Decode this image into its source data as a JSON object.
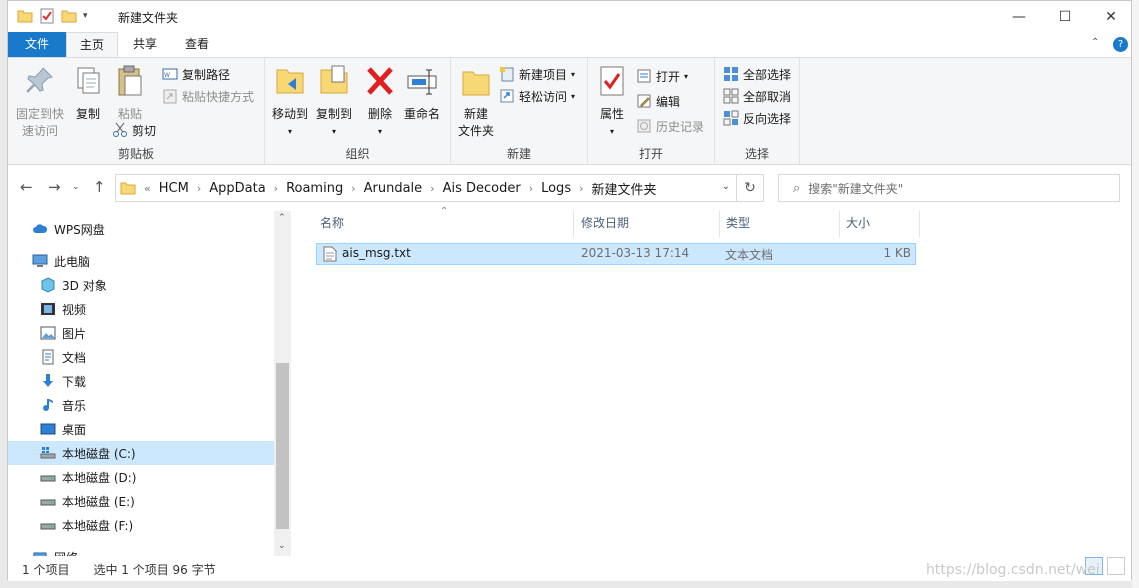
{
  "window": {
    "title": "新建文件夹",
    "controls": {
      "minimize": "—",
      "maximize": "☐",
      "close": "✕"
    }
  },
  "tabs": [
    "文件",
    "主页",
    "共享",
    "查看"
  ],
  "ribbon": {
    "clipboard": {
      "label": "剪贴板",
      "pin_line1": "固定到快",
      "pin_line2": "速访问",
      "copy": "复制",
      "paste": "粘贴",
      "copy_path": "复制路径",
      "paste_shortcut": "粘贴快捷方式",
      "cut": "剪切"
    },
    "organize": {
      "label": "组织",
      "move_to": "移动到",
      "copy_to": "复制到",
      "delete": "删除",
      "rename": "重命名"
    },
    "new": {
      "label": "新建",
      "new_folder_line1": "新建",
      "new_folder_line2": "文件夹",
      "new_item": "新建项目",
      "easy_access": "轻松访问"
    },
    "open": {
      "label": "打开",
      "properties": "属性",
      "open": "打开",
      "edit": "编辑",
      "history": "历史记录"
    },
    "select": {
      "label": "选择",
      "select_all": "全部选择",
      "select_none": "全部取消",
      "invert": "反向选择"
    }
  },
  "address": {
    "crumbs": [
      "HCM",
      "AppData",
      "Roaming",
      "Arundale",
      "Ais Decoder",
      "Logs",
      "新建文件夹"
    ],
    "overflow": "«",
    "search_placeholder": "搜索\"新建文件夹\""
  },
  "nav": {
    "items": [
      {
        "label": "WPS网盘",
        "icon": "cloud-icon"
      },
      {
        "label": "此电脑",
        "icon": "computer-icon"
      },
      {
        "label": "3D 对象",
        "icon": "cube-icon"
      },
      {
        "label": "视频",
        "icon": "video-icon"
      },
      {
        "label": "图片",
        "icon": "picture-icon"
      },
      {
        "label": "文档",
        "icon": "document-icon"
      },
      {
        "label": "下载",
        "icon": "download-icon"
      },
      {
        "label": "音乐",
        "icon": "music-icon"
      },
      {
        "label": "桌面",
        "icon": "desktop-icon"
      },
      {
        "label": "本地磁盘 (C:)",
        "icon": "drive-icon"
      },
      {
        "label": "本地磁盘 (D:)",
        "icon": "drive-icon"
      },
      {
        "label": "本地磁盘 (E:)",
        "icon": "drive-icon"
      },
      {
        "label": "本地磁盘 (F:)",
        "icon": "drive-icon"
      },
      {
        "label": "网络",
        "icon": "network-icon"
      }
    ]
  },
  "columns": [
    "名称",
    "修改日期",
    "类型",
    "大小"
  ],
  "files": [
    {
      "name": "ais_msg.txt",
      "modified": "2021-03-13 17:14",
      "type": "文本文档",
      "size": "1 KB"
    }
  ],
  "status": {
    "count": "1 个项目",
    "selected": "选中 1 个项目  96 字节"
  },
  "watermark": "https://blog.csdn.net/wei",
  "colors": {
    "file_tab": "#1979ca",
    "selection": "#cce8ff",
    "selection_border": "#99d1ff"
  }
}
